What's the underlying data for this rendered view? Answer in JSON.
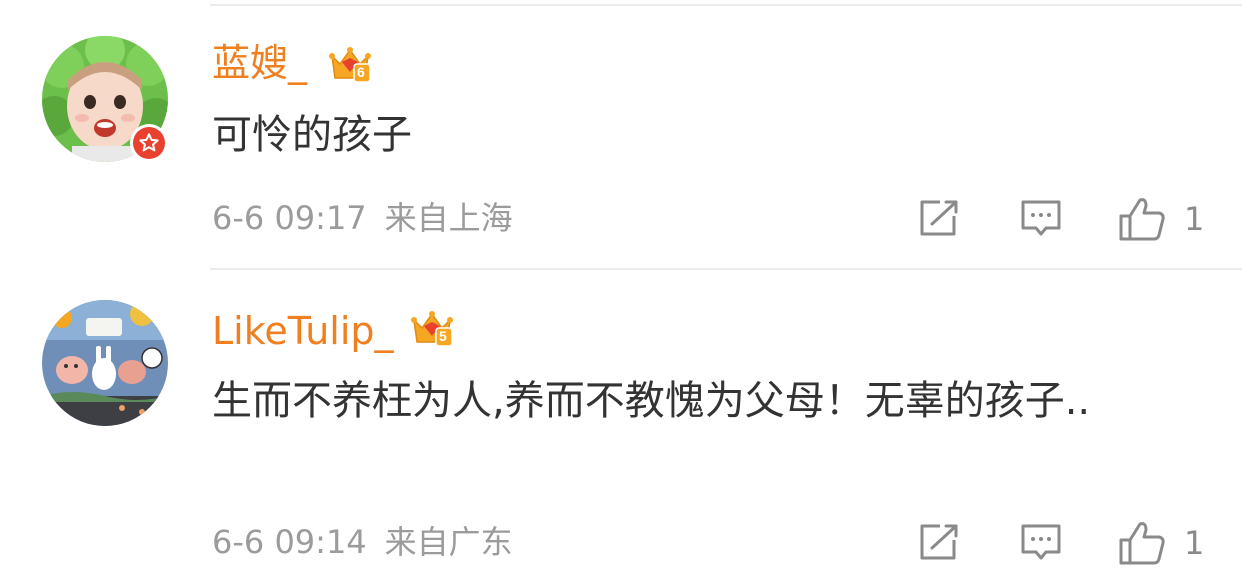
{
  "comments": [
    {
      "username": "蓝嫂_",
      "level": "6",
      "content": "可怜的孩子",
      "date": "6-6 09:17",
      "location": "来自上海",
      "likes": "1",
      "verified": true,
      "avatar_theme": "green-hood-girl"
    },
    {
      "username": "LikeTulip_",
      "level": "5",
      "content": "生而不养枉为人,养而不教愧为父母！无辜的孩子..",
      "date": "6-6 09:14",
      "location": "来自广东",
      "likes": "1",
      "verified": false,
      "avatar_theme": "cartoon-animals"
    }
  ],
  "icons": {
    "repost": "share-icon",
    "comment": "comment-icon",
    "like": "thumbs-up-icon"
  },
  "colors": {
    "username": "#f07f20",
    "content": "#333333",
    "meta": "#9b9b9b",
    "icon": "#8a8a8a",
    "vbadge": "#e8412f",
    "crown": "#f5a623"
  }
}
